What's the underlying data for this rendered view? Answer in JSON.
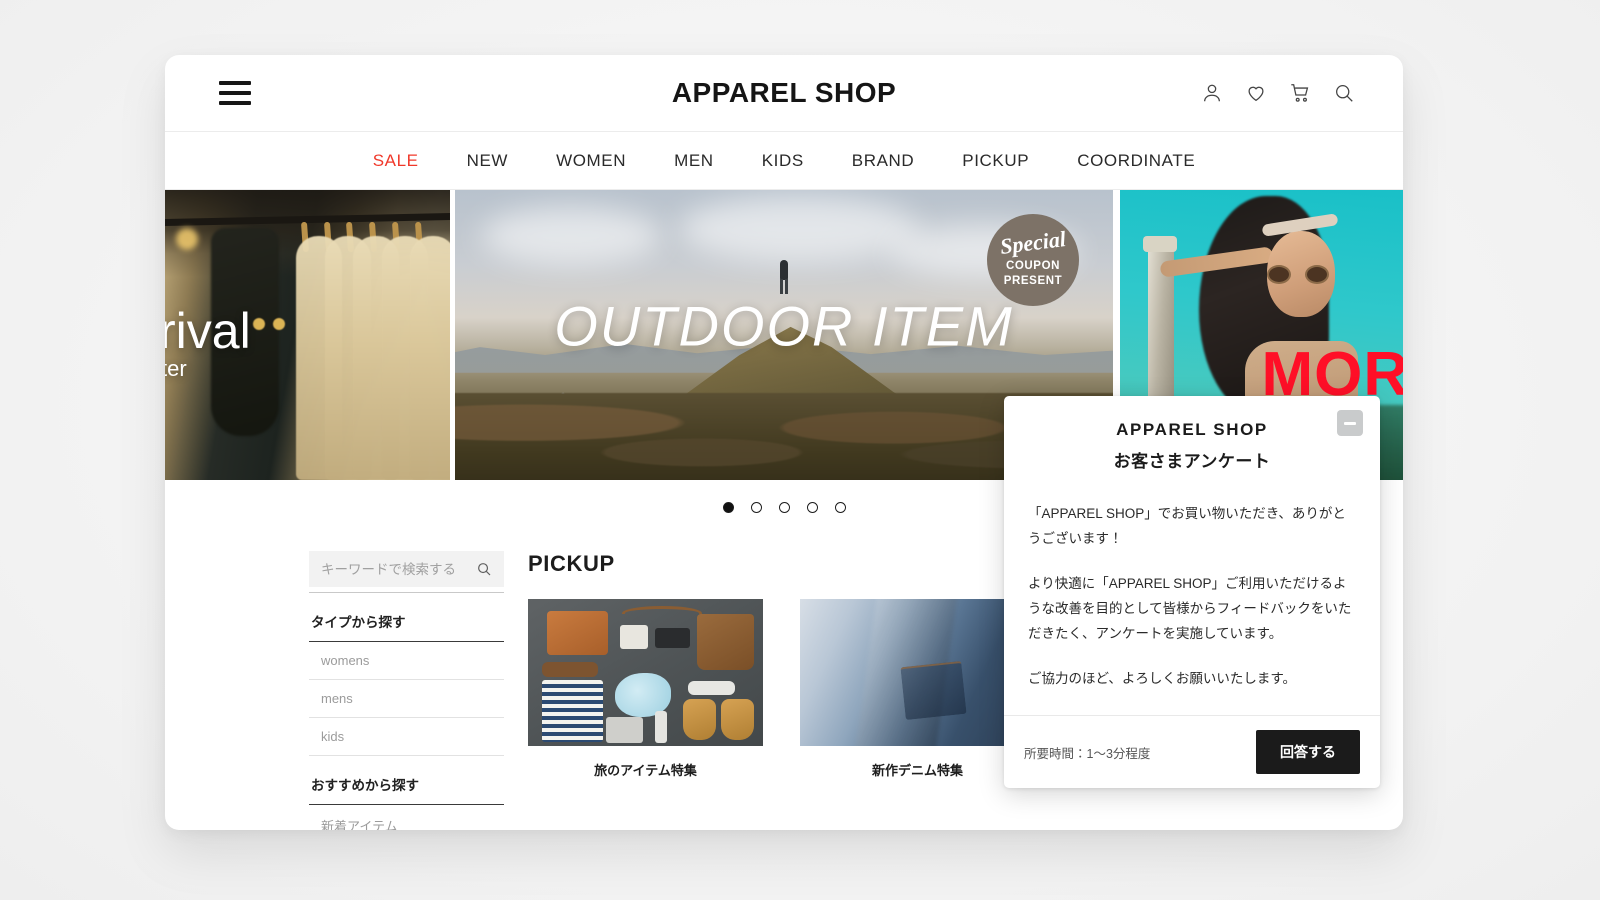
{
  "header": {
    "brand": "APPAREL SHOP",
    "menu_icon": "hamburger-icon",
    "icons": [
      {
        "name": "account-icon",
        "label": "Account"
      },
      {
        "name": "wishlist-heart-icon",
        "label": "Wishlist"
      },
      {
        "name": "cart-icon",
        "label": "Cart"
      },
      {
        "name": "search-icon",
        "label": "Search"
      }
    ]
  },
  "nav": {
    "items": [
      {
        "label": "SALE",
        "active": true,
        "color": "#f0392b"
      },
      {
        "label": "NEW",
        "active": false
      },
      {
        "label": "WOMEN",
        "active": false
      },
      {
        "label": "MEN",
        "active": false
      },
      {
        "label": "KIDS",
        "active": false
      },
      {
        "label": "BRAND",
        "active": false
      },
      {
        "label": "PICKUP",
        "active": false
      },
      {
        "label": "COORDINATE",
        "active": false
      }
    ]
  },
  "hero": {
    "slides": [
      {
        "id": "slide-new-arrival",
        "title_fragment": "rival",
        "subtitle_fragment": "ter",
        "full_title": "New Arrival",
        "full_subtitle": "Winter"
      },
      {
        "id": "slide-outdoor",
        "title": "OUTDOOR ITEM"
      },
      {
        "id": "slide-more",
        "title_fragment": "MOR",
        "full_title": "MORE"
      }
    ],
    "badge": {
      "script": "Special",
      "line1": "COUPON",
      "line2": "PRESENT",
      "color": "#7d7267"
    },
    "dots": [
      {
        "index": 1,
        "active": true
      },
      {
        "index": 2,
        "active": false
      },
      {
        "index": 3,
        "active": false
      },
      {
        "index": 4,
        "active": false
      },
      {
        "index": 5,
        "active": false
      }
    ]
  },
  "sidebar": {
    "search": {
      "placeholder": "キーワードで検索する",
      "value": "",
      "icon": "search-icon"
    },
    "groups": [
      {
        "heading": "タイプから探す",
        "links": [
          "womens",
          "mens",
          "kids"
        ]
      },
      {
        "heading": "おすすめから探す",
        "links": [
          "新着アイテム"
        ]
      }
    ]
  },
  "pickup": {
    "title": "PICKUP",
    "cards": [
      {
        "caption": "旅のアイテム特集",
        "art": "travel-flatlay"
      },
      {
        "caption": "新作デニム特集",
        "art": "denim"
      }
    ]
  },
  "survey_modal": {
    "brand": "APPAREL SHOP",
    "subtitle": "お客さまアンケート",
    "minimize_icon": "minimize-icon",
    "paragraphs": [
      "「APPAREL SHOP」でお買い物いただき、ありがとうございます！",
      "より快適に「APPAREL SHOP」ご利用いただけるような改善を目的として皆様からフィードバックをいただきたく、アンケートを実施しています。",
      "ご協力のほど、よろしくお願いいたします。"
    ],
    "duration": "所要時間：1〜3分程度",
    "submit_label": "回答する"
  }
}
